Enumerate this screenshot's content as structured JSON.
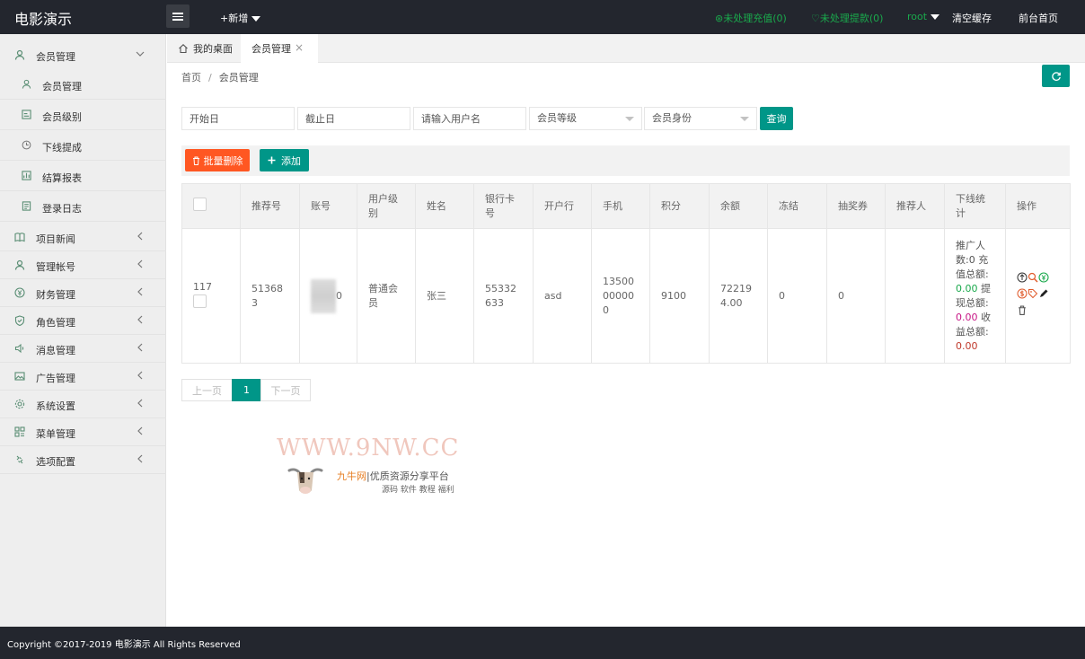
{
  "app": {
    "title": "电影演示"
  },
  "topbar": {
    "new_label": "+新增",
    "recharge_label": "未处理充值(0)",
    "withdraw_label": "未处理提款(0)",
    "user_label": "root",
    "clear_cache_label": "清空缓存",
    "front_home_label": "前台首页"
  },
  "sidebar": {
    "groups": [
      {
        "label": "会员管理",
        "icon": "user-icon",
        "expanded": true,
        "children": [
          {
            "label": "会员管理",
            "icon": "user-icon"
          },
          {
            "label": "会员级别",
            "icon": "level-icon"
          },
          {
            "label": "下线提成",
            "icon": "clock-icon"
          },
          {
            "label": "结算报表",
            "icon": "report-icon"
          },
          {
            "label": "登录日志",
            "icon": "log-icon"
          }
        ]
      },
      {
        "label": "项目新闻",
        "icon": "book-icon"
      },
      {
        "label": "管理帐号",
        "icon": "user-icon"
      },
      {
        "label": "财务管理",
        "icon": "finance-icon"
      },
      {
        "label": "角色管理",
        "icon": "shield-icon"
      },
      {
        "label": "消息管理",
        "icon": "speaker-icon"
      },
      {
        "label": "广告管理",
        "icon": "image-icon"
      },
      {
        "label": "系统设置",
        "icon": "gear-icon"
      },
      {
        "label": "菜单管理",
        "icon": "menu-icon"
      },
      {
        "label": "选项配置",
        "icon": "puzzle-icon"
      }
    ]
  },
  "tabs": {
    "home_label": "我的桌面",
    "active_label": "会员管理"
  },
  "breadcrumb": {
    "home": "首页",
    "sep": "/",
    "current": "会员管理"
  },
  "filters": {
    "start_placeholder": "开始日",
    "end_placeholder": "截止日",
    "username_placeholder": "请输入用户名",
    "level_select": "会员等级",
    "identity_select": "会员身份",
    "query_label": "查询"
  },
  "toolbar": {
    "batch_delete_label": "批量删除",
    "add_label": "添加"
  },
  "table": {
    "headers": [
      "推荐号",
      "账号",
      "用户级别",
      "姓名",
      "银行卡号",
      "开户行",
      "手机",
      "积分",
      "余额",
      "冻结",
      "抽奖券",
      "推荐人",
      "下线统计",
      "操作"
    ],
    "rows": [
      {
        "id": "117",
        "ref_no": "513683",
        "account_suffix": "0",
        "level": "普通会员",
        "name": "张三",
        "bank_card": "55332633",
        "bank": "asd",
        "phone": "13500000000",
        "points": "9100",
        "balance": "722194.00",
        "frozen": "0",
        "tickets": "0",
        "referrer": "",
        "stats": {
          "promoted_label": "推广人数:",
          "promoted": "0",
          "recharge_label": "充值总额:",
          "recharge": "0.00",
          "withdraw_label": "提现总额:",
          "withdraw": "0.00",
          "income_label": "收益总额:",
          "income": "0.00"
        }
      }
    ]
  },
  "pager": {
    "prev": "上一页",
    "current": "1",
    "next": "下一页"
  },
  "watermark": {
    "url": "WWW.9NW.CC",
    "brand": "九牛网",
    "slogan": "优质资源分享平台",
    "tags": "源码 软件 教程 福利"
  },
  "footer": {
    "copyright": "Copyright ©2017-2019 电影演示 All Rights Reserved"
  },
  "colors": {
    "primary": "#009688",
    "danger": "#ff5722",
    "topbar": "#23262e",
    "green_text": "#1aa94c"
  }
}
